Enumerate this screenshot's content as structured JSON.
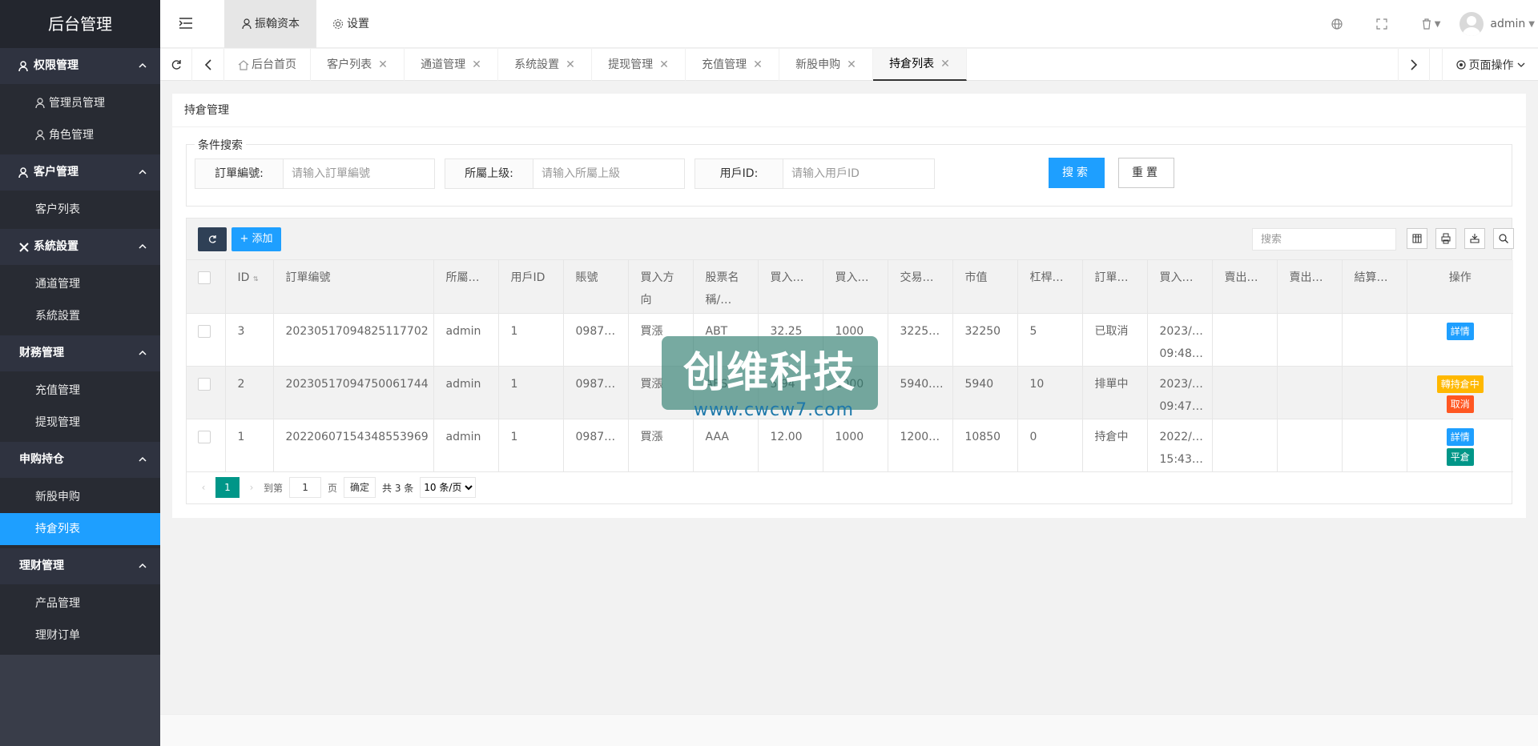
{
  "app": {
    "title": "后台管理"
  },
  "sidebar": {
    "groups": [
      {
        "title": "权限管理",
        "items": [
          "管理员管理",
          "角色管理"
        ]
      },
      {
        "title": "客户管理",
        "items": [
          "客户列表"
        ]
      },
      {
        "title": "系統設置",
        "items": [
          "通道管理",
          "系統設置"
        ]
      },
      {
        "title": "财務管理",
        "items": [
          "充值管理",
          "提现管理"
        ]
      },
      {
        "title": "申购持仓",
        "items": [
          "新股申购",
          "持倉列表"
        ]
      },
      {
        "title": "理财管理",
        "items": [
          "产品管理",
          "理财订单"
        ]
      }
    ]
  },
  "header": {
    "top_tabs": [
      "振翰资本",
      "设置"
    ],
    "user": "admin"
  },
  "tabs": {
    "items": [
      "后台首页",
      "客户列表",
      "通道管理",
      "系统設置",
      "提现管理",
      "充值管理",
      "新股申购",
      "持倉列表"
    ],
    "page_ops": "页面操作"
  },
  "card": {
    "title": "持倉管理",
    "search_legend": "条件搜索",
    "fields": [
      {
        "label": "訂單編號:",
        "placeholder": "请输入訂單編號"
      },
      {
        "label": "所屬上级:",
        "placeholder": "请输入所屬上級"
      },
      {
        "label": "用戶ID:",
        "placeholder": "请输入用戶ID"
      }
    ],
    "search_btn": "搜索",
    "reset_btn": "重置"
  },
  "toolbar": {
    "add": "+ 添加",
    "search_placeholder": "搜索"
  },
  "table": {
    "headers": [
      "ID",
      "訂單编號",
      "所屬…",
      "用戶ID",
      "賬號",
      "買入方向",
      "股票名稱/…",
      "買入…",
      "買入…",
      "交易…",
      "市值",
      "杠桿…",
      "訂單…",
      "買入…",
      "賣出…",
      "賣出…",
      "結算…",
      "操作"
    ],
    "rows": [
      {
        "id": "3",
        "order": "20230517094825117702",
        "parent": "admin",
        "uid": "1",
        "acct": "0987…",
        "dir": "買漲",
        "stock": "ABT",
        "price": "32.25",
        "qty": "1000",
        "trade": "3225…",
        "mv": "32250",
        "lev": "5",
        "status": "已取消",
        "buy_date": "2023/…",
        "buy_time": "09:48…",
        "actions": [
          "詳情"
        ]
      },
      {
        "id": "2",
        "order": "20230517094750061744",
        "parent": "admin",
        "uid": "1",
        "acct": "0987…",
        "dir": "買漲",
        "stock": "ABS",
        "price": "5.94",
        "qty": "1000",
        "trade": "5940.…",
        "mv": "5940",
        "lev": "10",
        "status": "排單中",
        "buy_date": "2023/…",
        "buy_time": "09:47…",
        "actions": [
          "轉持倉中",
          "取消"
        ]
      },
      {
        "id": "1",
        "order": "20220607154348553969",
        "parent": "admin",
        "uid": "1",
        "acct": "0987…",
        "dir": "買漲",
        "stock": "AAA",
        "price": "12.00",
        "qty": "1000",
        "trade": "1200…",
        "mv": "10850",
        "lev": "0",
        "status": "持倉中",
        "buy_date": "2022/…",
        "buy_time": "15:43…",
        "actions": [
          "詳情",
          "平倉"
        ]
      }
    ]
  },
  "pager": {
    "current": "1",
    "goto_label": "到第",
    "page_input": "1",
    "page_unit": "页",
    "confirm": "确定",
    "total": "共 3 条",
    "per_page": "10 条/页"
  },
  "watermark": {
    "text": "创维科技",
    "url": "www.cwcw7.com"
  }
}
